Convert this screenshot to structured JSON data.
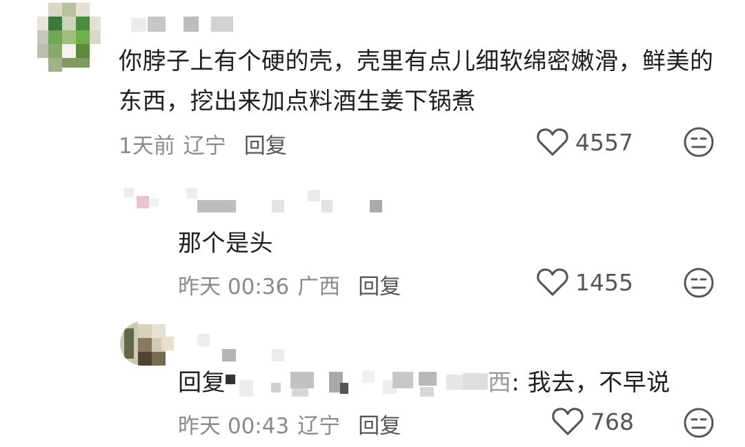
{
  "comments": [
    {
      "text": "你脖子上有个硬的壳，壳里有点儿细软绵密嫩滑，鲜美的东西，挖出来加点料酒生姜下锅煮",
      "time": "1天前",
      "location": "辽宁",
      "reply_label": "回复",
      "likes": "4557"
    },
    {
      "text": "那个是头",
      "time": "昨天 00:36",
      "location": "广西",
      "reply_label": "回复",
      "likes": "1455"
    },
    {
      "reply_prefix": "回复",
      "reply_target_tail": "西",
      "text": ": 我去，不早说",
      "time": "昨天 00:43",
      "location": "辽宁",
      "reply_label": "回复",
      "likes": "768"
    }
  ],
  "icons": {
    "like": "heart-outline-icon",
    "dislike": "meh-face-icon"
  }
}
